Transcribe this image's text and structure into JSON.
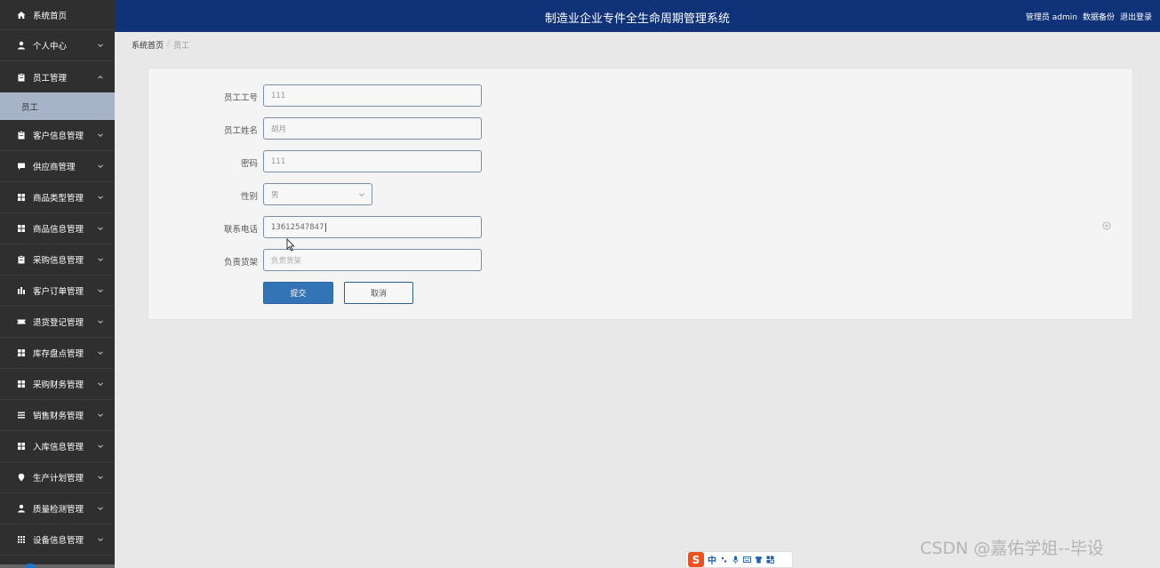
{
  "header": {
    "title": "制造业企业专件全生命周期管理系统",
    "user": "管理员 admin",
    "backup": "数据备份",
    "logout": "退出登录"
  },
  "sidebar": {
    "items": [
      {
        "label": "系统首页",
        "icon": "home-icon"
      },
      {
        "label": "个人中心",
        "icon": "user-icon"
      },
      {
        "label": "员工管理",
        "icon": "clipboard-icon",
        "sub": "员工"
      },
      {
        "label": "客户信息管理",
        "icon": "clipboard-icon"
      },
      {
        "label": "供应商管理",
        "icon": "comment-icon"
      },
      {
        "label": "商品类型管理",
        "icon": "grid-icon"
      },
      {
        "label": "商品信息管理",
        "icon": "grid-icon"
      },
      {
        "label": "采购信息管理",
        "icon": "clipboard-icon"
      },
      {
        "label": "客户订单管理",
        "icon": "chart-icon"
      },
      {
        "label": "退货登记管理",
        "icon": "ticket-icon"
      },
      {
        "label": "库存盘点管理",
        "icon": "grid-icon"
      },
      {
        "label": "采购财务管理",
        "icon": "grid-icon"
      },
      {
        "label": "销售财务管理",
        "icon": "list-icon"
      },
      {
        "label": "入库信息管理",
        "icon": "grid-icon"
      },
      {
        "label": "生产计划管理",
        "icon": "pin-icon"
      },
      {
        "label": "质量检测管理",
        "icon": "user-icon"
      },
      {
        "label": "设备信息管理",
        "icon": "grid-icon"
      }
    ]
  },
  "breadcrumb": {
    "home": "系统首页",
    "separator": "/",
    "current": "员工"
  },
  "form": {
    "fields": [
      {
        "label": "员工工号",
        "value": "111",
        "placeholder": "员工工号"
      },
      {
        "label": "员工姓名",
        "value": "胡月",
        "placeholder": "员工姓名"
      },
      {
        "label": "密码",
        "value": "111",
        "placeholder": "密码"
      },
      {
        "label": "性别",
        "value": "男",
        "placeholder": "性别"
      },
      {
        "label": "联系电话",
        "value": "13612547847",
        "placeholder": "联系电话"
      },
      {
        "label": "负责货架",
        "value": "",
        "placeholder": "负责货架"
      }
    ],
    "submit": "提交",
    "cancel": "取消"
  },
  "ime": {
    "logo": "S",
    "mode": "中"
  },
  "watermark": "CSDN @嘉佑学姐--毕设"
}
